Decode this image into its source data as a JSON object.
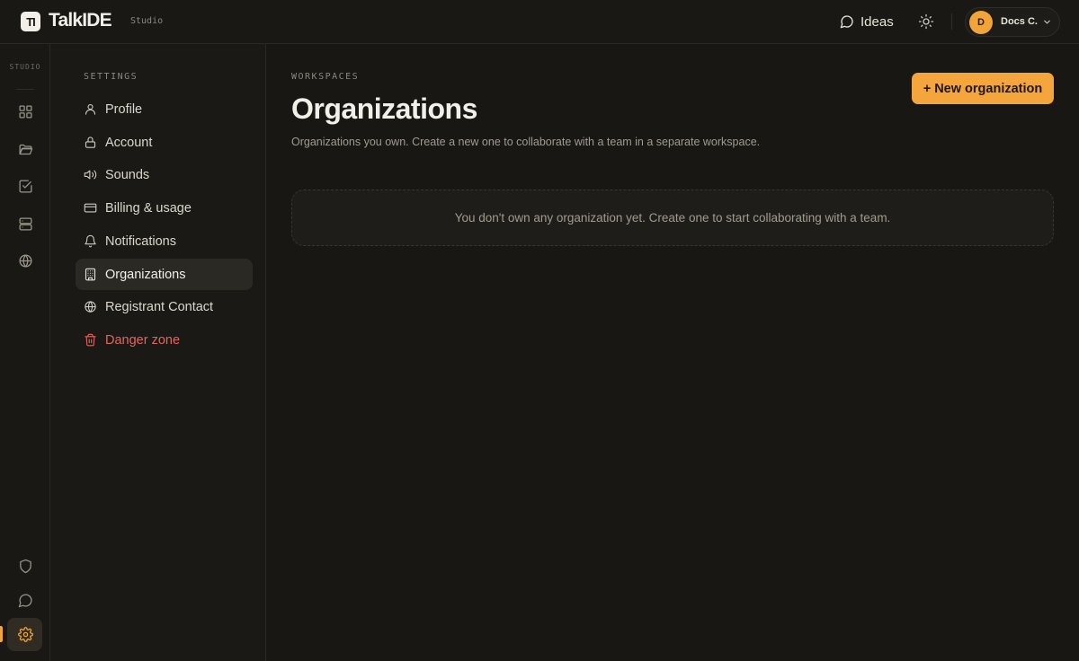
{
  "app": {
    "logo_mark": "TI",
    "name": "TalkIDE",
    "edition": "Studio"
  },
  "topbar": {
    "ideas_label": "Ideas",
    "theme_icon": "sun-icon",
    "user": {
      "initial": "D",
      "name": "Docs C."
    }
  },
  "rail": {
    "label": "STUDIO",
    "items": [
      {
        "icon": "grid-icon"
      },
      {
        "icon": "folder-icon"
      },
      {
        "icon": "checkbox-icon"
      },
      {
        "icon": "server-icon"
      },
      {
        "icon": "globe-icon"
      }
    ],
    "bottom_items": [
      {
        "icon": "shield-icon"
      },
      {
        "icon": "chat-icon"
      },
      {
        "icon": "gear-icon",
        "active": true
      }
    ]
  },
  "settings_nav": {
    "title": "SETTINGS",
    "items": [
      {
        "label": "Profile",
        "icon": "user-icon"
      },
      {
        "label": "Account",
        "icon": "lock-icon"
      },
      {
        "label": "Sounds",
        "icon": "speaker-icon"
      },
      {
        "label": "Billing & usage",
        "icon": "credit-card-icon"
      },
      {
        "label": "Notifications",
        "icon": "bell-icon"
      },
      {
        "label": "Organizations",
        "icon": "building-icon",
        "active": true
      },
      {
        "label": "Registrant Contact",
        "icon": "globe-icon"
      },
      {
        "label": "Danger zone",
        "icon": "trash-icon",
        "danger": true
      }
    ]
  },
  "main": {
    "eyebrow": "WORKSPACES",
    "title": "Organizations",
    "description": "Organizations you own. Create a new one to collaborate with a team in a separate workspace.",
    "new_button_label": "+ New organization",
    "empty_state": "You don't own any organization yet. Create one to start collaborating with a team."
  },
  "colors": {
    "background": "#181714",
    "accent": "#f4a63c",
    "danger": "#e0665c",
    "text": "#e8e4da",
    "muted": "#a19b8f"
  }
}
